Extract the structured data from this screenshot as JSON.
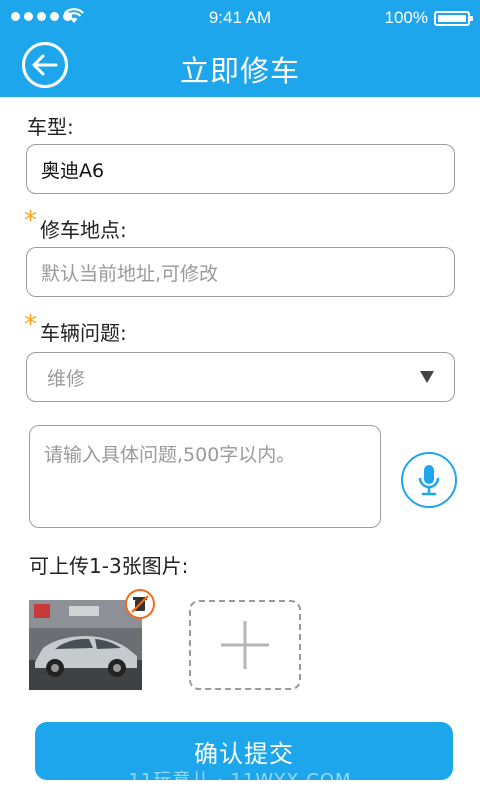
{
  "status_bar": {
    "time": "9:41 AM",
    "battery": "100%"
  },
  "header": {
    "title": "立即修车",
    "back_icon": "arrow-left-circle-icon"
  },
  "form": {
    "car_model": {
      "label": "车型:",
      "value": "奥迪A6"
    },
    "location": {
      "required_mark": "*",
      "label": "修车地点:",
      "placeholder": "默认当前地址,可修改"
    },
    "problem": {
      "required_mark": "*",
      "label": "车辆问题:",
      "selected": "维修"
    },
    "description": {
      "placeholder": "请输入具体问题,500字以内。"
    },
    "upload": {
      "label": "可上传1-3张图片:"
    }
  },
  "submit": {
    "label": "确认提交"
  },
  "watermark": "11玩意儿 · 11WYX.COM",
  "colors": {
    "primary": "#1ea6ec",
    "required": "#f5a623",
    "remove": "#f26b1d"
  }
}
